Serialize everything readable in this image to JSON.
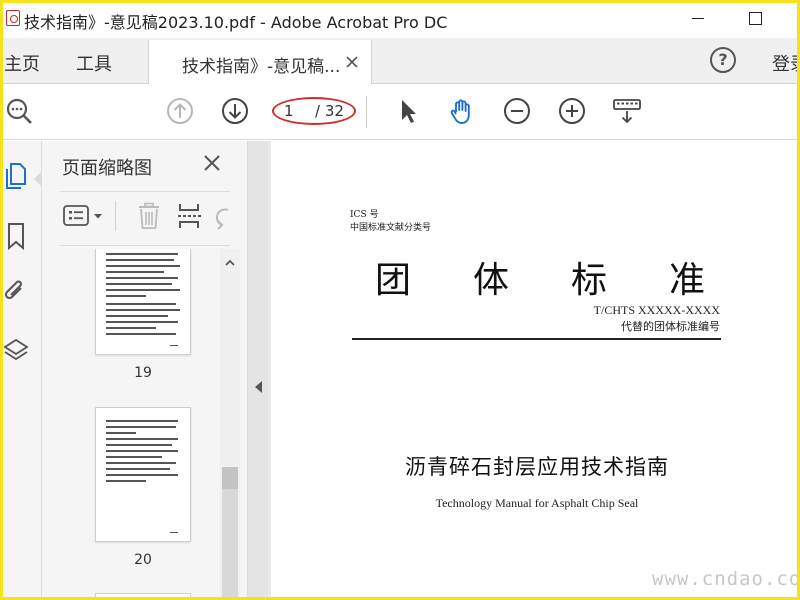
{
  "window": {
    "title": "技术指南》-意见稿2023.10.pdf - Adobe Acrobat Pro DC",
    "app_icon": "acrobat-icon",
    "controls": [
      "minimize-icon",
      "maximize-icon"
    ]
  },
  "menu_tabs": {
    "home": "主页",
    "tools": "工具",
    "document_tab": "技术指南》-意见稿...",
    "login": "登录",
    "help_icon": "help-icon",
    "help_glyph": "?"
  },
  "toolbar": {
    "icons": [
      "search-icon",
      "previous-page-icon",
      "next-page-icon",
      "select-pointer-icon",
      "hand-tool-icon",
      "zoom-out-icon",
      "zoom-in-icon",
      "keyboard-read-icon"
    ],
    "current_page": "1",
    "total_pages": "/ 32",
    "accent_color": "#1f6fd0",
    "highlight_oval_color": "#d82a2a"
  },
  "left_rail": {
    "icons": [
      "page-thumbnails-icon",
      "bookmark-icon",
      "attachment-icon",
      "layers-icon"
    ]
  },
  "thumbnail_panel": {
    "title": "页面缩略图",
    "thumbnails": [
      {
        "page_label": "19"
      },
      {
        "page_label": "20"
      }
    ]
  },
  "document": {
    "ics_label": "ICS 号",
    "classification_label": "中国标准文献分类号",
    "standard_type_chars": [
      "团",
      "体",
      "标",
      "准"
    ],
    "standard_code": "T/CHTS XXXXX-XXXX",
    "replaces_label": "代替的团体标准编号",
    "title_cn": "沥青碎石封层应用技术指南",
    "title_en": "Technology Manual for Asphalt Chip Seal"
  },
  "watermark": "www.cndao.com",
  "frame_color": "#f4e21c"
}
